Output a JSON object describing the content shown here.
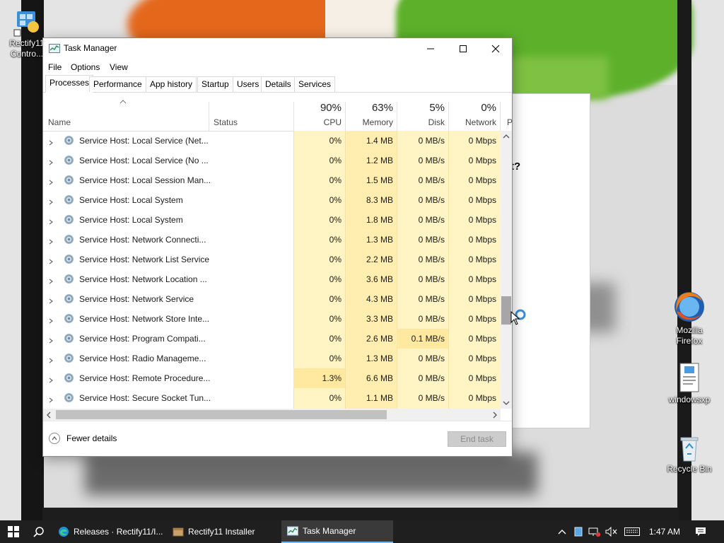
{
  "desktop": {
    "icons": [
      {
        "label": "Rectify11 Contro...",
        "icon": "control-panel-icon"
      },
      {
        "label": "Mozilla Firefox",
        "icon": "firefox-icon"
      },
      {
        "label": "windowsxp",
        "icon": "document-icon"
      },
      {
        "label": "Recycle Bin",
        "icon": "recycle-bin-icon"
      }
    ],
    "dialog_fragment": "t?"
  },
  "window": {
    "title": "Task Manager",
    "menu": [
      "File",
      "Options",
      "View"
    ],
    "tabs": [
      "Processes",
      "Performance",
      "App history",
      "Startup",
      "Users",
      "Details",
      "Services"
    ],
    "active_tab": "Processes"
  },
  "columns": {
    "name": "Name",
    "status": "Status",
    "cpu": {
      "pct": "90%",
      "label": "CPU"
    },
    "memory": {
      "pct": "63%",
      "label": "Memory"
    },
    "disk": {
      "pct": "5%",
      "label": "Disk"
    },
    "network": {
      "pct": "0%",
      "label": "Network"
    },
    "power_partial": "P"
  },
  "processes": [
    {
      "name": "Service Host: Local Service (Net...",
      "cpu": "0%",
      "memory": "1.4 MB",
      "disk": "0 MB/s",
      "network": "0 Mbps"
    },
    {
      "name": "Service Host: Local Service (No ...",
      "cpu": "0%",
      "memory": "1.2 MB",
      "disk": "0 MB/s",
      "network": "0 Mbps"
    },
    {
      "name": "Service Host: Local Session Man...",
      "cpu": "0%",
      "memory": "1.5 MB",
      "disk": "0 MB/s",
      "network": "0 Mbps"
    },
    {
      "name": "Service Host: Local System",
      "cpu": "0%",
      "memory": "8.3 MB",
      "disk": "0 MB/s",
      "network": "0 Mbps"
    },
    {
      "name": "Service Host: Local System",
      "cpu": "0%",
      "memory": "1.8 MB",
      "disk": "0 MB/s",
      "network": "0 Mbps"
    },
    {
      "name": "Service Host: Network Connecti...",
      "cpu": "0%",
      "memory": "1.3 MB",
      "disk": "0 MB/s",
      "network": "0 Mbps"
    },
    {
      "name": "Service Host: Network List Service",
      "cpu": "0%",
      "memory": "2.2 MB",
      "disk": "0 MB/s",
      "network": "0 Mbps"
    },
    {
      "name": "Service Host: Network Location ...",
      "cpu": "0%",
      "memory": "3.6 MB",
      "disk": "0 MB/s",
      "network": "0 Mbps"
    },
    {
      "name": "Service Host: Network Service",
      "cpu": "0%",
      "memory": "4.3 MB",
      "disk": "0 MB/s",
      "network": "0 Mbps"
    },
    {
      "name": "Service Host: Network Store Inte...",
      "cpu": "0%",
      "memory": "3.3 MB",
      "disk": "0 MB/s",
      "network": "0 Mbps"
    },
    {
      "name": "Service Host: Program Compati...",
      "cpu": "0%",
      "memory": "2.6 MB",
      "disk": "0.1 MB/s",
      "network": "0 Mbps"
    },
    {
      "name": "Service Host: Radio Manageme...",
      "cpu": "0%",
      "memory": "1.3 MB",
      "disk": "0 MB/s",
      "network": "0 Mbps"
    },
    {
      "name": "Service Host: Remote Procedure...",
      "cpu": "1.3%",
      "memory": "6.6 MB",
      "disk": "0 MB/s",
      "network": "0 Mbps"
    },
    {
      "name": "Service Host: Secure Socket Tun...",
      "cpu": "0%",
      "memory": "1.1 MB",
      "disk": "0 MB/s",
      "network": "0 Mbps"
    }
  ],
  "footer": {
    "fewer_details": "Fewer details",
    "end_task": "End task"
  },
  "taskbar": {
    "items": [
      {
        "label": "Releases · Rectify11/I...",
        "icon": "edge-icon"
      },
      {
        "label": "Rectify11 Installer",
        "icon": "installer-icon"
      },
      {
        "label": "Task Manager",
        "icon": "task-manager-icon"
      }
    ],
    "active": "Task Manager",
    "clock": "1:47 AM"
  },
  "colors": {
    "heat_light": "#fff4c4",
    "heat_mid": "#ffe9a0",
    "accent": "#76b9ed",
    "taskbar": "#1f1f1f"
  }
}
